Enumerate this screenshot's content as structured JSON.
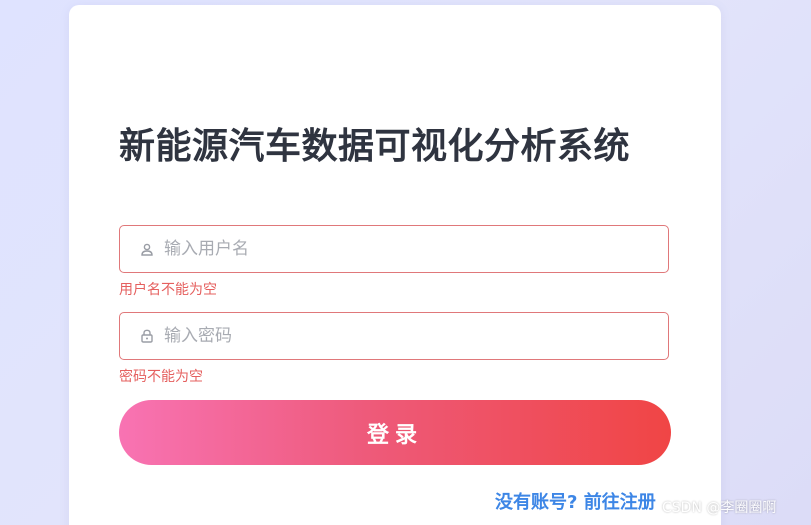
{
  "page": {
    "title": "新能源汽车数据可视化分析系统"
  },
  "form": {
    "username": {
      "placeholder": "输入用户名",
      "value": "",
      "error": "用户名不能为空",
      "icon": "user-icon"
    },
    "password": {
      "placeholder": "输入密码",
      "value": "",
      "error": "密码不能为空",
      "icon": "lock-icon"
    },
    "login_label": "登录",
    "register_link": "没有账号? 前往注册"
  },
  "watermark": "CSDN @李圈圈啊",
  "colors": {
    "error": "#e5605f",
    "link": "#3d86e6",
    "button_start": "#f873b3",
    "button_end": "#f04545",
    "title": "#2f3440"
  }
}
